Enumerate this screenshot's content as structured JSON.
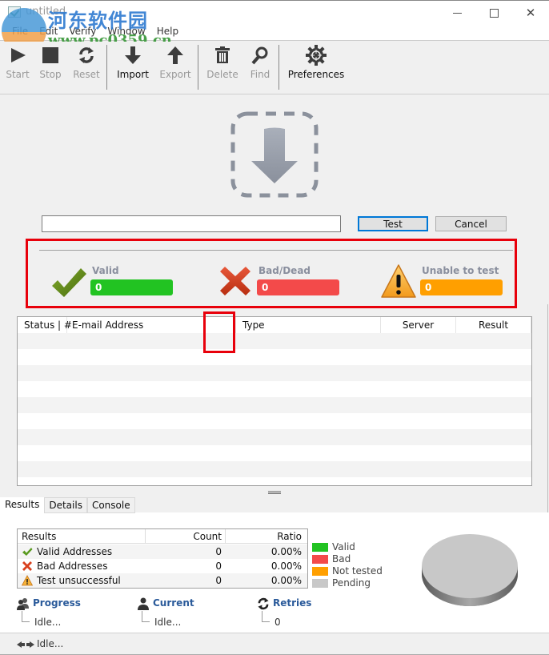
{
  "window": {
    "title": "untitled",
    "controls": {
      "minimize": "minimize",
      "maximize": "maximize",
      "close": "close"
    }
  },
  "watermark": {
    "site_name": "河东软件园",
    "url": "www.pc0359.cn"
  },
  "menu": [
    "File",
    "Edit",
    "Verify",
    "Window",
    "Help"
  ],
  "toolbar": {
    "start": {
      "label": "Start",
      "icon": "play-icon",
      "enabled": false
    },
    "stop": {
      "label": "Stop",
      "icon": "stop-icon",
      "enabled": false
    },
    "reset": {
      "label": "Reset",
      "icon": "refresh-icon",
      "enabled": false
    },
    "import": {
      "label": "Import",
      "icon": "arrow-down-icon",
      "enabled": true
    },
    "export": {
      "label": "Export",
      "icon": "arrow-up-icon",
      "enabled": false
    },
    "delete": {
      "label": "Delete",
      "icon": "trash-icon",
      "enabled": false
    },
    "find": {
      "label": "Find",
      "icon": "magnifier-icon",
      "enabled": false
    },
    "preferences": {
      "label": "Preferences",
      "icon": "gear-icon",
      "enabled": true
    }
  },
  "dropzone": {
    "icon": "drop-download-icon"
  },
  "input": {
    "value": "",
    "placeholder": ""
  },
  "buttons": {
    "test": "Test",
    "cancel": "Cancel"
  },
  "stats": {
    "valid": {
      "label": "Valid",
      "value": "0",
      "color": "#22c322"
    },
    "bad": {
      "label": "Bad/Dead",
      "value": "0",
      "color": "#f34a4a"
    },
    "unable": {
      "label": "Unable to test",
      "value": "0",
      "color": "#ff9f00"
    }
  },
  "email_table": {
    "columns": [
      "Status | #",
      "E-mail Address",
      "Type",
      "Server",
      "Result"
    ],
    "rows": []
  },
  "tabs": [
    {
      "label": "Results",
      "active": true
    },
    {
      "label": "Details",
      "active": false
    },
    {
      "label": "Console",
      "active": false
    }
  ],
  "results_table": {
    "columns": [
      "Results",
      "Count",
      "Ratio"
    ],
    "rows": [
      {
        "label": "Valid Addresses",
        "icon": "check-icon",
        "count": "0",
        "ratio": "0.00%"
      },
      {
        "label": "Bad Addresses",
        "icon": "x-icon",
        "count": "0",
        "ratio": "0.00%"
      },
      {
        "label": "Test unsuccessful",
        "icon": "warning-icon",
        "count": "0",
        "ratio": "0.00%"
      }
    ]
  },
  "legend": [
    {
      "label": "Valid",
      "color": "#22c322"
    },
    {
      "label": "Bad",
      "color": "#f34a4a"
    },
    {
      "label": "Not tested",
      "color": "#ff9f00"
    },
    {
      "label": "Pending",
      "color": "#c8c8c8"
    }
  ],
  "pie": {
    "valid": 0,
    "bad": 0,
    "not_tested": 0,
    "pending": 100
  },
  "info": {
    "progress": {
      "title": "Progress",
      "value": "Idle..."
    },
    "current": {
      "title": "Current",
      "value": "Idle..."
    },
    "retries": {
      "title": "Retries",
      "value": "0"
    }
  },
  "status": {
    "text": "Idle..."
  }
}
